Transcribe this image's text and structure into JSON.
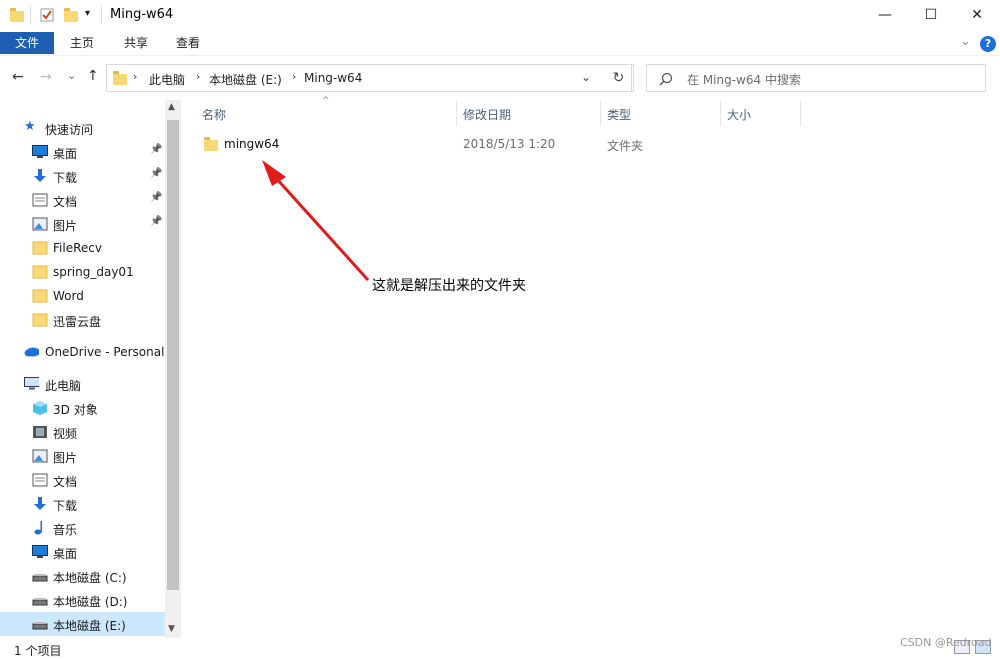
{
  "window": {
    "title": "Ming-w64",
    "minimize": "—",
    "maximize": "☐",
    "close": "✕"
  },
  "ribbon": {
    "tabs": [
      "文件",
      "主页",
      "共享",
      "查看"
    ],
    "expand": "⌄",
    "help": "?"
  },
  "nav_buttons": {
    "back": "←",
    "forward": "→",
    "recent": "⌄",
    "up": "↑"
  },
  "address": {
    "crumbs": [
      "此电脑",
      "本地磁盘 (E:)",
      "Ming-w64"
    ],
    "dropdown": "⌄",
    "refresh": "↻"
  },
  "search": {
    "placeholder": "在 Ming-w64 中搜索",
    "icon": "search-icon"
  },
  "sidebar": {
    "quick_access": "快速访问",
    "quick_items": [
      {
        "label": "桌面",
        "icon": "desktop-icon",
        "pinned": true
      },
      {
        "label": "下载",
        "icon": "download-icon",
        "pinned": true
      },
      {
        "label": "文档",
        "icon": "documents-icon",
        "pinned": true
      },
      {
        "label": "图片",
        "icon": "pictures-icon",
        "pinned": true
      },
      {
        "label": "FileRecv",
        "icon": "folder-icon",
        "pinned": false
      },
      {
        "label": "spring_day01",
        "icon": "folder-icon",
        "pinned": false
      },
      {
        "label": "Word",
        "icon": "folder-icon",
        "pinned": false
      },
      {
        "label": "迅雷云盘",
        "icon": "folder-icon",
        "pinned": false
      }
    ],
    "onedrive": "OneDrive - Personal",
    "this_pc": "此电脑",
    "pc_items": [
      {
        "label": "3D 对象",
        "icon": "3d-objects-icon"
      },
      {
        "label": "视频",
        "icon": "videos-icon"
      },
      {
        "label": "图片",
        "icon": "pictures-icon"
      },
      {
        "label": "文档",
        "icon": "documents-icon"
      },
      {
        "label": "下载",
        "icon": "download-icon"
      },
      {
        "label": "音乐",
        "icon": "music-icon"
      },
      {
        "label": "桌面",
        "icon": "desktop-icon"
      },
      {
        "label": "本地磁盘 (C:)",
        "icon": "drive-icon"
      },
      {
        "label": "本地磁盘 (D:)",
        "icon": "drive-icon"
      },
      {
        "label": "本地磁盘 (E:)",
        "icon": "drive-icon",
        "selected": true
      }
    ]
  },
  "columns": [
    "名称",
    "修改日期",
    "类型",
    "大小"
  ],
  "files": [
    {
      "name": "mingw64",
      "modified": "2018/5/13 1:20",
      "type": "文件夹",
      "size": ""
    }
  ],
  "annotation": "这就是解压出来的文件夹",
  "status": "1 个项目",
  "watermark": "CSDN @Redroad",
  "colors": {
    "accent": "#1e5fb4",
    "folder": "#f8d775",
    "arrow": "#e11b1b",
    "selected": "#cce8ff"
  }
}
